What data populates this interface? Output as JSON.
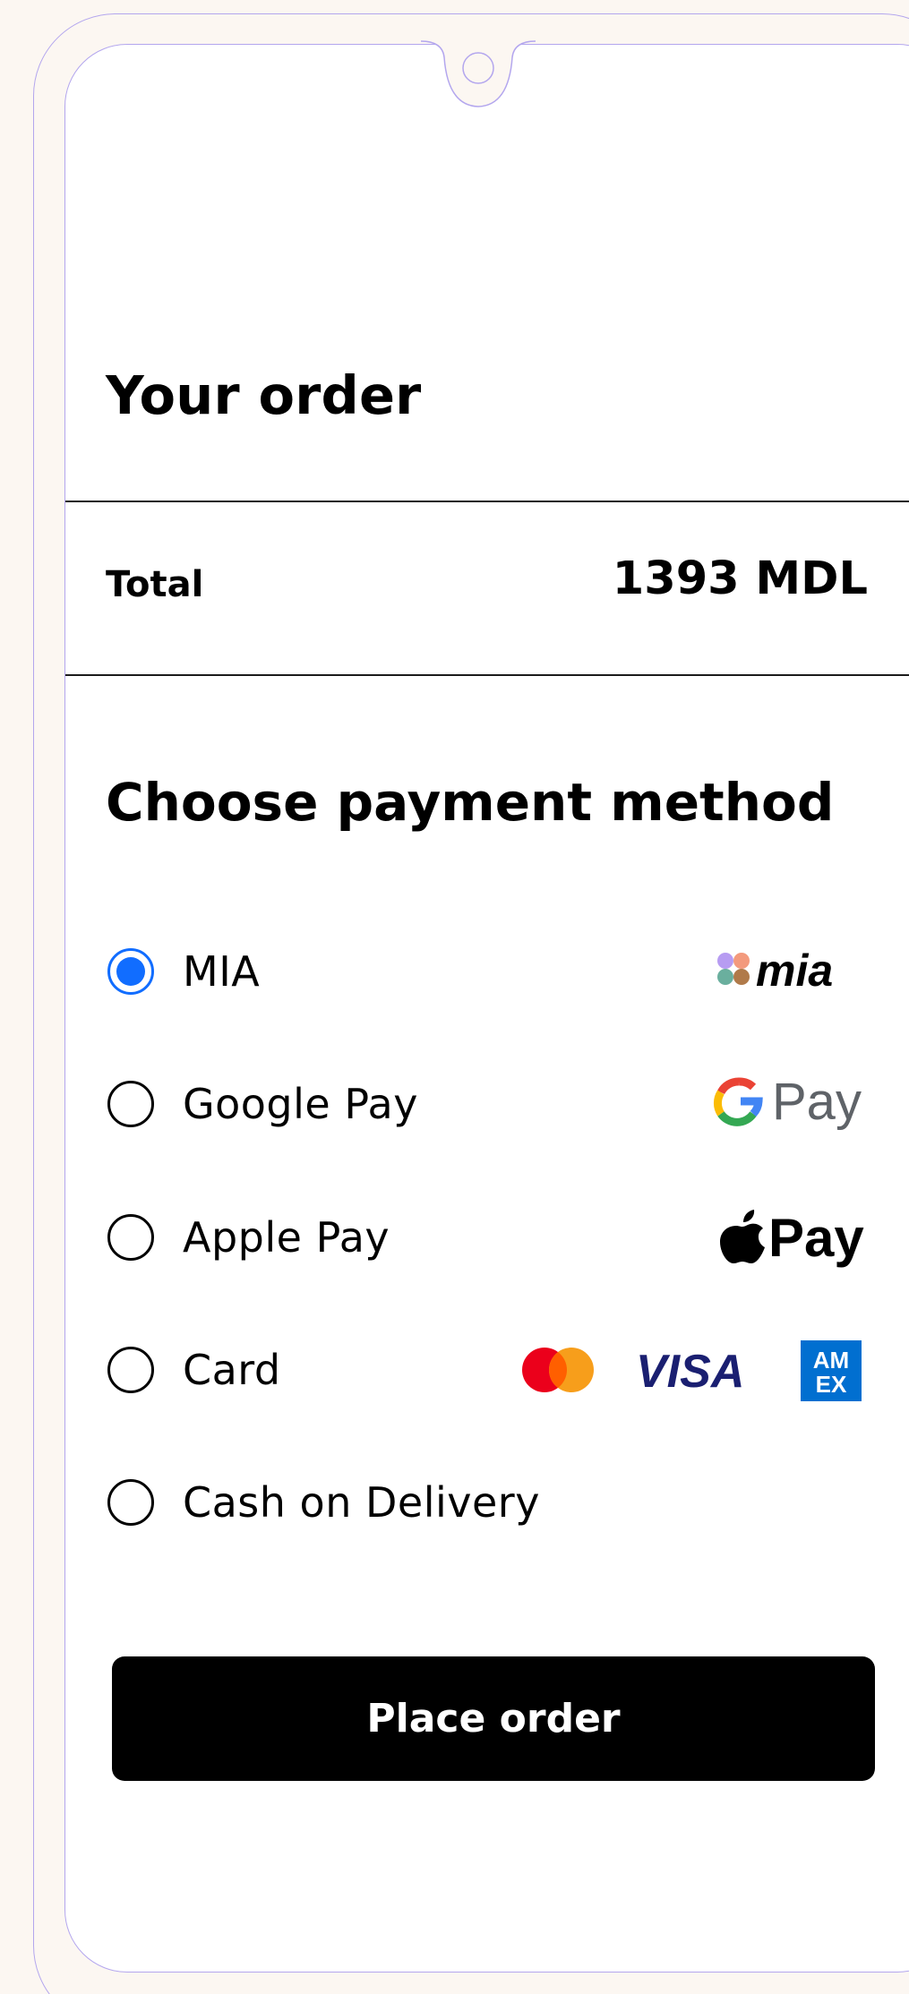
{
  "order": {
    "title": "Your order",
    "total_label": "Total",
    "total_value": "1393 MDL"
  },
  "payment": {
    "title": "Choose payment method",
    "selected": "MIA",
    "options": [
      {
        "label": "MIA",
        "logo": "mia-logo",
        "selected": true
      },
      {
        "label": "Google Pay",
        "logo": "google-pay-logo",
        "selected": false
      },
      {
        "label": "Apple Pay",
        "logo": "apple-pay-logo",
        "selected": false
      },
      {
        "label": "Card",
        "logo": "card-brands-logos",
        "selected": false
      },
      {
        "label": "Cash on Delivery",
        "logo": "",
        "selected": false
      }
    ],
    "logos": {
      "mia_text": "mia",
      "gpay_text": "Pay",
      "applepay_text": "Pay",
      "visa_text": "VISA",
      "amex_text_top": "AM",
      "amex_text_bottom": "EX"
    }
  },
  "actions": {
    "place_order": "Place order"
  },
  "colors": {
    "accent": "#116dff",
    "frame": "#b3a6ee",
    "background": "#fcf7f2",
    "button": "#000000"
  }
}
